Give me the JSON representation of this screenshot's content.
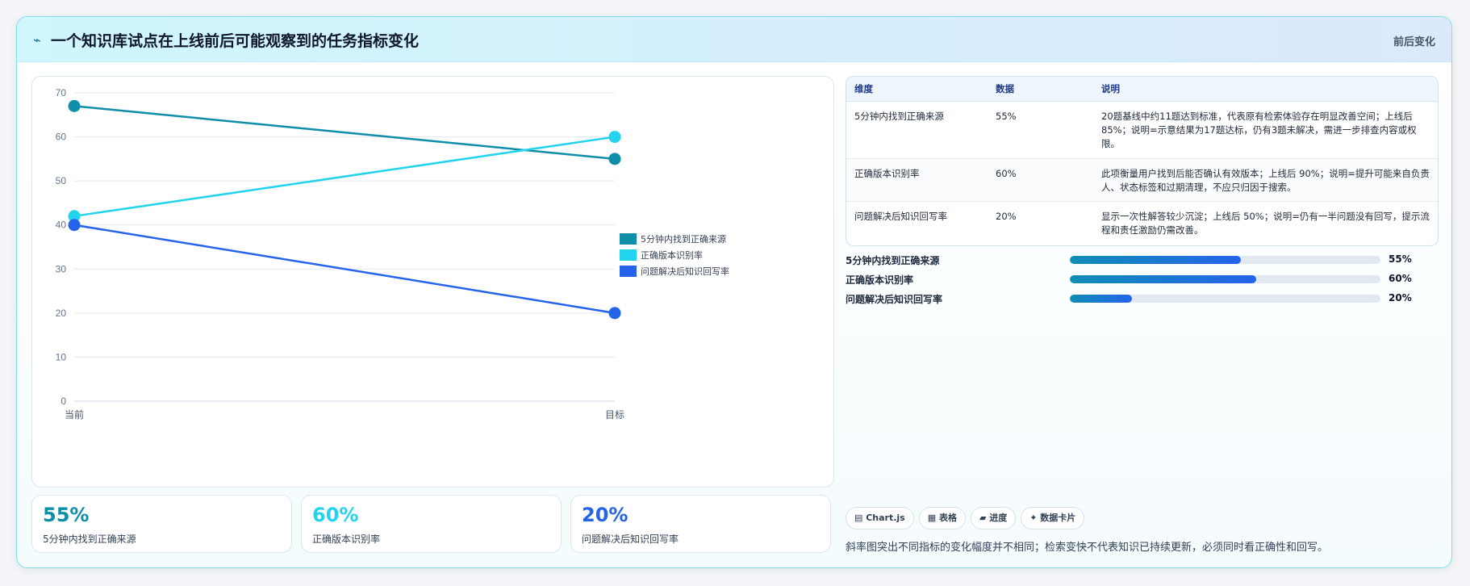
{
  "header": {
    "icon": "⌁",
    "title": "一个知识库试点在上线前后可能观察到的任务指标变化",
    "tag": "前后变化"
  },
  "chart_data": {
    "type": "line",
    "title": "",
    "xlabel": "",
    "ylabel": "",
    "categories": [
      "当前",
      "目标"
    ],
    "ylim": [
      0,
      70
    ],
    "yticks": [
      0,
      10,
      20,
      30,
      40,
      50,
      60,
      70
    ],
    "grid": true,
    "legend_position": "right",
    "series": [
      {
        "name": "5分钟内找到正确来源",
        "values": [
          67,
          55
        ],
        "color": "#0e8ea9"
      },
      {
        "name": "正确版本识别率",
        "values": [
          42,
          60
        ],
        "color": "#22d3ee"
      },
      {
        "name": "问题解决后知识回写率",
        "values": [
          40,
          20
        ],
        "color": "#2563eb"
      }
    ]
  },
  "stats": [
    {
      "value": "55%",
      "label": "5分钟内找到正确来源",
      "color": "#0e8ea9"
    },
    {
      "value": "60%",
      "label": "正确版本识别率",
      "color": "#22d3ee"
    },
    {
      "value": "20%",
      "label": "问题解决后知识回写率",
      "color": "#2563eb"
    }
  ],
  "table": {
    "headers": [
      "维度",
      "数据",
      "说明"
    ],
    "rows": [
      [
        "5分钟内找到正确来源",
        "55%",
        "20题基线中约11题达到标准，代表原有检索体验存在明显改善空间；上线后 85%；说明=示意结果为17题达标，仍有3题未解决，需进一步排查内容或权限。"
      ],
      [
        "正确版本识别率",
        "60%",
        "此项衡量用户找到后能否确认有效版本；上线后 90%；说明=提升可能来自负责人、状态标签和过期清理，不应只归因于搜索。"
      ],
      [
        "问题解决后知识回写率",
        "20%",
        "显示一次性解答较少沉淀；上线后 50%；说明=仍有一半问题没有回写，提示流程和责任激励仍需改善。"
      ]
    ]
  },
  "progress": [
    {
      "label": "5分钟内找到正确来源",
      "value": 55,
      "display": "55%"
    },
    {
      "label": "正确版本识别率",
      "value": 60,
      "display": "60%"
    },
    {
      "label": "问题解决后知识回写率",
      "value": 20,
      "display": "20%"
    }
  ],
  "chips": [
    "▤ Chart.js",
    "▦ 表格",
    "▰ 进度",
    "✦ 数据卡片"
  ],
  "footnote": "斜率图突出不同指标的变化幅度并不相同；检索变快不代表知识已持续更新，必须同时看正确性和回写。"
}
